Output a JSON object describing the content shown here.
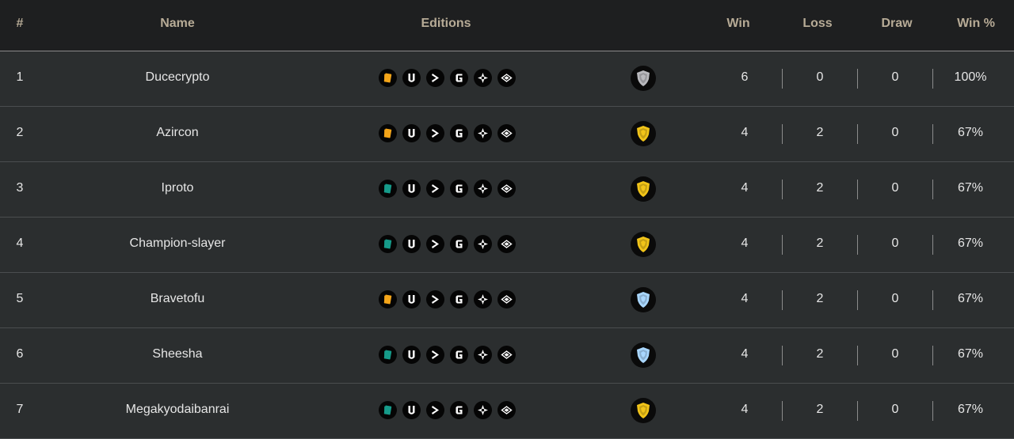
{
  "header": {
    "rank": "#",
    "name": "Name",
    "editions": "Editions",
    "win": "Win",
    "loss": "Loss",
    "draw": "Draw",
    "win_pct": "Win %"
  },
  "colors": {
    "gold_deck": "#f3a51a",
    "teal_deck": "#169b8a",
    "silver_league": "#b9b9bd",
    "gold_league": "#f1c419",
    "diamond_league": "#a9d7ff"
  },
  "rows": [
    {
      "rank": "1",
      "name": "Ducecrypto",
      "deck_color": "gold",
      "league": "silver",
      "win": "6",
      "loss": "0",
      "draw": "0",
      "win_pct": "100%"
    },
    {
      "rank": "2",
      "name": "Azircon",
      "deck_color": "gold",
      "league": "gold",
      "win": "4",
      "loss": "2",
      "draw": "0",
      "win_pct": "67%"
    },
    {
      "rank": "3",
      "name": "Iproto",
      "deck_color": "teal",
      "league": "gold",
      "win": "4",
      "loss": "2",
      "draw": "0",
      "win_pct": "67%"
    },
    {
      "rank": "4",
      "name": "Champion-slayer",
      "deck_color": "teal",
      "league": "gold",
      "win": "4",
      "loss": "2",
      "draw": "0",
      "win_pct": "67%"
    },
    {
      "rank": "5",
      "name": "Bravetofu",
      "deck_color": "gold",
      "league": "diamond",
      "win": "4",
      "loss": "2",
      "draw": "0",
      "win_pct": "67%"
    },
    {
      "rank": "6",
      "name": "Sheesha",
      "deck_color": "teal",
      "league": "diamond",
      "win": "4",
      "loss": "2",
      "draw": "0",
      "win_pct": "67%"
    },
    {
      "rank": "7",
      "name": "Megakyodaibanrai",
      "deck_color": "teal",
      "league": "gold",
      "win": "4",
      "loss": "2",
      "draw": "0",
      "win_pct": "67%"
    }
  ],
  "edition_icons": [
    "deck-icon",
    "untamed-icon",
    "chaos-icon",
    "gladius-icon",
    "riftwatchers-icon",
    "promo-icon"
  ]
}
